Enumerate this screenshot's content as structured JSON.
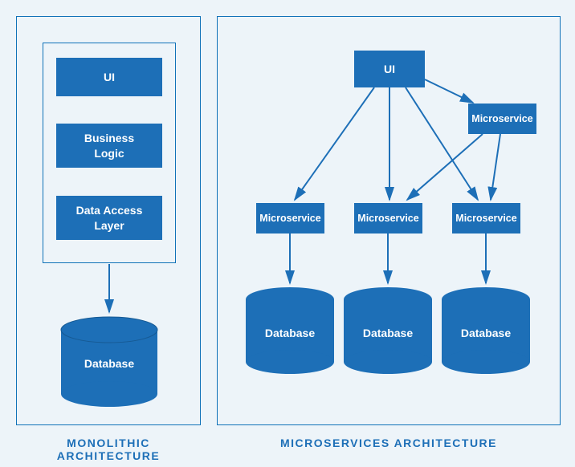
{
  "left": {
    "title": "MONOLITHIC ARCHITECTURE",
    "blocks": {
      "ui": "UI",
      "business": "Business\nLogic",
      "data": "Data Access\nLayer"
    },
    "database": "Database"
  },
  "right": {
    "title": "MICROSERVICES ARCHITECTURE",
    "ui": "UI",
    "microservices": {
      "top": "Microservice",
      "a": "Microservice",
      "b": "Microservice",
      "c": "Microservice"
    },
    "databases": {
      "a": "Database",
      "b": "Database",
      "c": "Database"
    }
  },
  "colors": {
    "primary": "#1d6fb7",
    "border": "#1072b8",
    "bg": "#edf4f9"
  }
}
